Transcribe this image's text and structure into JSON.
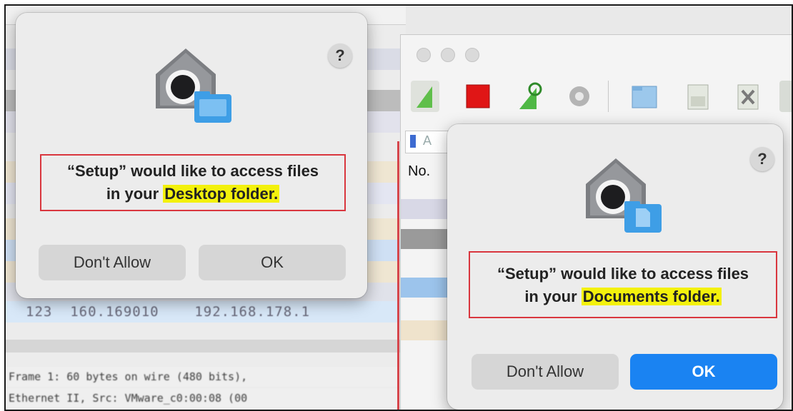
{
  "background_window": {
    "packet_row": "123  160.169010    192.168.178.1",
    "details": [
      "Frame 1: 60 bytes on wire (480 bits),",
      "Ethernet II, Src: VMware_c0:00:08 (00"
    ],
    "column_header": "No.",
    "filter_placeholder": "A"
  },
  "dialog_desktop": {
    "help": "?",
    "line1": "“Setup” would like to access files",
    "line2_prefix": "in your ",
    "line2_highlight": "Desktop folder.",
    "deny_label": "Don't Allow",
    "ok_label": "OK"
  },
  "dialog_documents": {
    "help": "?",
    "line1": "“Setup” would like to access files",
    "line2_prefix": "in your ",
    "line2_highlight": "Documents folder.",
    "deny_label": "Don't Allow",
    "ok_label": "OK"
  },
  "colors": {
    "highlight": "#f3f10c",
    "annotation_border": "#d9363e",
    "primary_button": "#1a83f2",
    "dialog_bg": "#ececec"
  },
  "icons": [
    "privacy-shield-folder-icon",
    "privacy-shield-document-icon",
    "help-icon",
    "shark-fin-icon",
    "stop-icon",
    "restart-icon",
    "options-icon",
    "open-file-icon",
    "save-file-icon",
    "close-file-icon",
    "bookmark-icon"
  ]
}
